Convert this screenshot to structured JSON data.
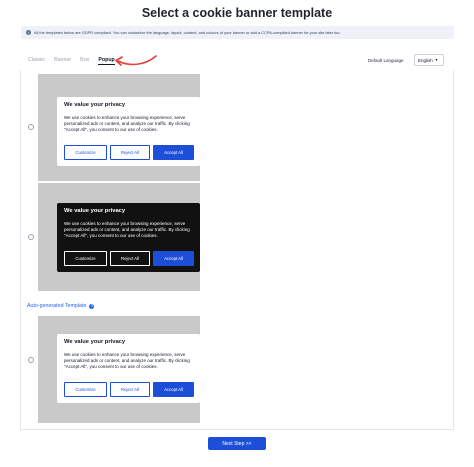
{
  "page": {
    "title": "Select a cookie banner template",
    "info": "All the templates below are GDPR compliant. You can customize the language, layout, content, and colours of your banner or add a CCPA-compliant banner for your site later too."
  },
  "tabs": [
    "Classic",
    "Banner",
    "Box",
    "Popup"
  ],
  "active_tab": "Popup",
  "language": {
    "label": "Default Language",
    "selected": "English"
  },
  "templates": [
    {
      "theme": "light",
      "title": "We value your privacy",
      "body": "We use cookies to enhance your browsing experience, serve personalized ads or content, and analyze our traffic. By clicking \"Accept All\", you consent to our use of cookies.",
      "buttons": [
        "Customize",
        "Reject All",
        "Accept All"
      ]
    },
    {
      "theme": "dark",
      "title": "We value your privacy",
      "body": "We use cookies to enhance your browsing experience, serve personalized ads or content, and analyze our traffic. By clicking \"Accept All\", you consent to our use of cookies.",
      "buttons": [
        "Customize",
        "Reject All",
        "Accept All"
      ]
    },
    {
      "theme": "light",
      "title": "We value your privacy",
      "body": "We use cookies to enhance your browsing experience, serve personalized ads or content, and analyze our traffic. By clicking \"Accept All\", you consent to our use of cookies.",
      "buttons": [
        "Customize",
        "Reject All",
        "Accept All"
      ]
    }
  ],
  "auto_generated_label": "Auto-generated Template",
  "next_button": "Next Step >>",
  "colors": {
    "accent": "#1d4ed8",
    "arrow": "#e0433a",
    "preview_bg": "#c9c9c9"
  }
}
